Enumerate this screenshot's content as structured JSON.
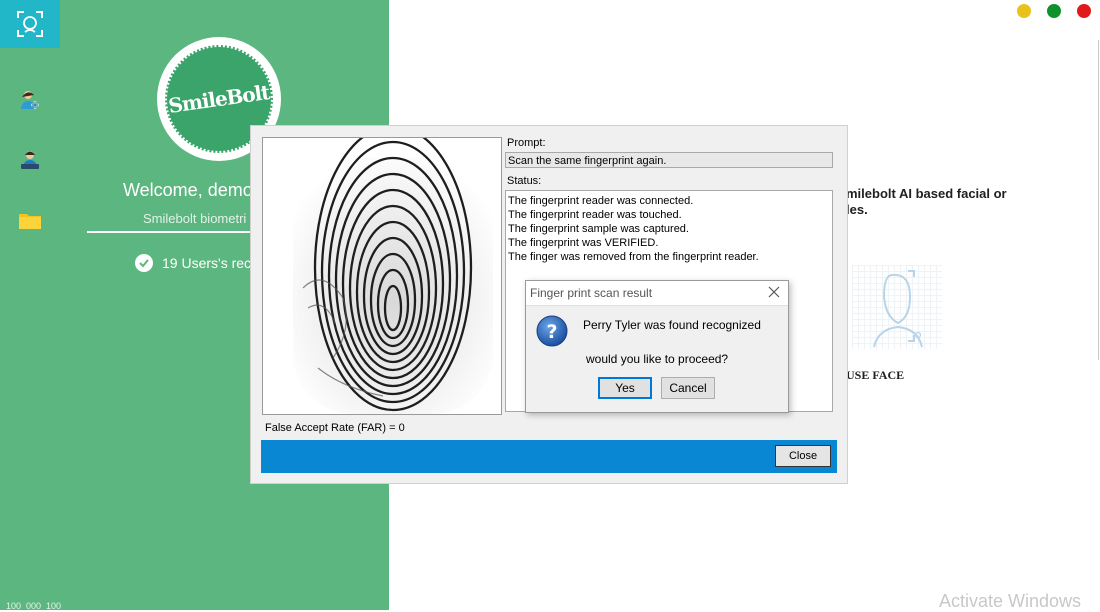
{
  "sidebar": {
    "logo_text": "SmileBolt",
    "welcome": "Welcome, demo",
    "subtitle": "Smilebolt biometri",
    "users_recognized": "19 Users's reco",
    "bottom_text": "100_000_100"
  },
  "nav": {
    "items": [
      {
        "icon": "face-scan-icon"
      },
      {
        "icon": "add-user-icon"
      },
      {
        "icon": "user-laptop-icon"
      },
      {
        "icon": "folder-icon"
      }
    ]
  },
  "window_controls": {
    "colors": {
      "minimize": "#e8c21a",
      "maximize": "#10912c",
      "close": "#e11b1b"
    }
  },
  "right": {
    "desc_line1": "milebolt AI based facial or",
    "desc_line2": "les.",
    "use_face": "USE FACE"
  },
  "fp_dialog": {
    "prompt_label": "Prompt:",
    "prompt_value": "Scan the same fingerprint again.",
    "status_label": "Status:",
    "status_lines": [
      "The fingerprint reader was connected.",
      "The fingerprint reader was touched.",
      "The fingerprint sample was captured.",
      "The fingerprint was VERIFIED.",
      "The finger was removed from the fingerprint reader."
    ],
    "far_label": "False Accept Rate (FAR) = 0",
    "close_label": "Close"
  },
  "message_box": {
    "title": "Finger print scan result",
    "line1": "Perry Tyler was found recognized",
    "line2": "would you like to proceed?",
    "yes_label": "Yes",
    "cancel_label": "Cancel"
  },
  "watermark": "Activate Windows",
  "colors": {
    "sidebar": "#5cb67f",
    "nav_active": "#22b7c8",
    "dialog_bar": "#0a87d2"
  }
}
